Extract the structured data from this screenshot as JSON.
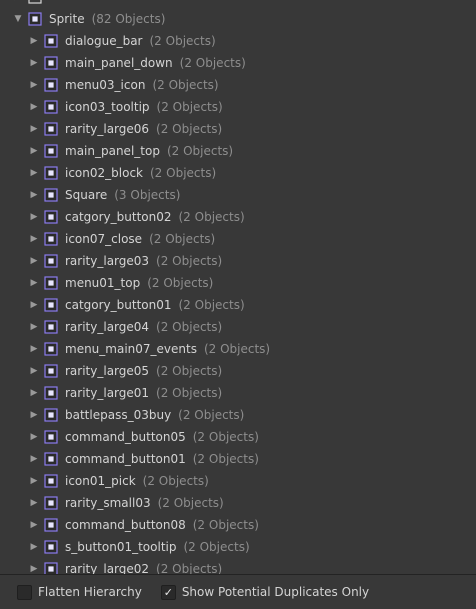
{
  "parent_row_partial": {
    "name": "",
    "count": ""
  },
  "group": {
    "name": "Sprite",
    "count": "(82 Objects)"
  },
  "items": [
    {
      "name": "dialogue_bar",
      "count": "(2 Objects)"
    },
    {
      "name": "main_panel_down",
      "count": "(2 Objects)"
    },
    {
      "name": "menu03_icon",
      "count": "(2 Objects)"
    },
    {
      "name": "icon03_tooltip",
      "count": "(2 Objects)"
    },
    {
      "name": "rarity_large06",
      "count": "(2 Objects)"
    },
    {
      "name": "main_panel_top",
      "count": "(2 Objects)"
    },
    {
      "name": "icon02_block",
      "count": "(2 Objects)"
    },
    {
      "name": "Square",
      "count": "(3 Objects)"
    },
    {
      "name": "catgory_button02",
      "count": "(2 Objects)"
    },
    {
      "name": "icon07_close",
      "count": "(2 Objects)"
    },
    {
      "name": "rarity_large03",
      "count": "(2 Objects)"
    },
    {
      "name": "menu01_top",
      "count": "(2 Objects)"
    },
    {
      "name": "catgory_button01",
      "count": "(2 Objects)"
    },
    {
      "name": "rarity_large04",
      "count": "(2 Objects)"
    },
    {
      "name": "menu_main07_events",
      "count": "(2 Objects)"
    },
    {
      "name": "rarity_large05",
      "count": "(2 Objects)"
    },
    {
      "name": "rarity_large01",
      "count": "(2 Objects)"
    },
    {
      "name": "battlepass_03buy",
      "count": "(2 Objects)"
    },
    {
      "name": "command_button05",
      "count": "(2 Objects)"
    },
    {
      "name": "command_button01",
      "count": "(2 Objects)"
    },
    {
      "name": "icon01_pick",
      "count": "(2 Objects)"
    },
    {
      "name": "rarity_small03",
      "count": "(2 Objects)"
    },
    {
      "name": "command_button08",
      "count": "(2 Objects)"
    },
    {
      "name": "s_button01_tooltip",
      "count": "(2 Objects)"
    },
    {
      "name": "rarity_large02",
      "count": "(2 Objects)"
    }
  ],
  "icons": {
    "expanded_arrow": "triangle-down-icon",
    "collapsed_arrow": "triangle-right-icon",
    "item_icon": "sprite-asset-icon"
  },
  "colors": {
    "background": "#383838",
    "text": "#d4d4d4",
    "count_text": "#8e8e8e",
    "sprite_icon": "#8b7cf0"
  },
  "footer": {
    "flatten_hierarchy": {
      "label": "Flatten Hierarchy",
      "checked": false
    },
    "show_duplicates": {
      "label": "Show Potential Duplicates Only",
      "checked": true
    }
  }
}
